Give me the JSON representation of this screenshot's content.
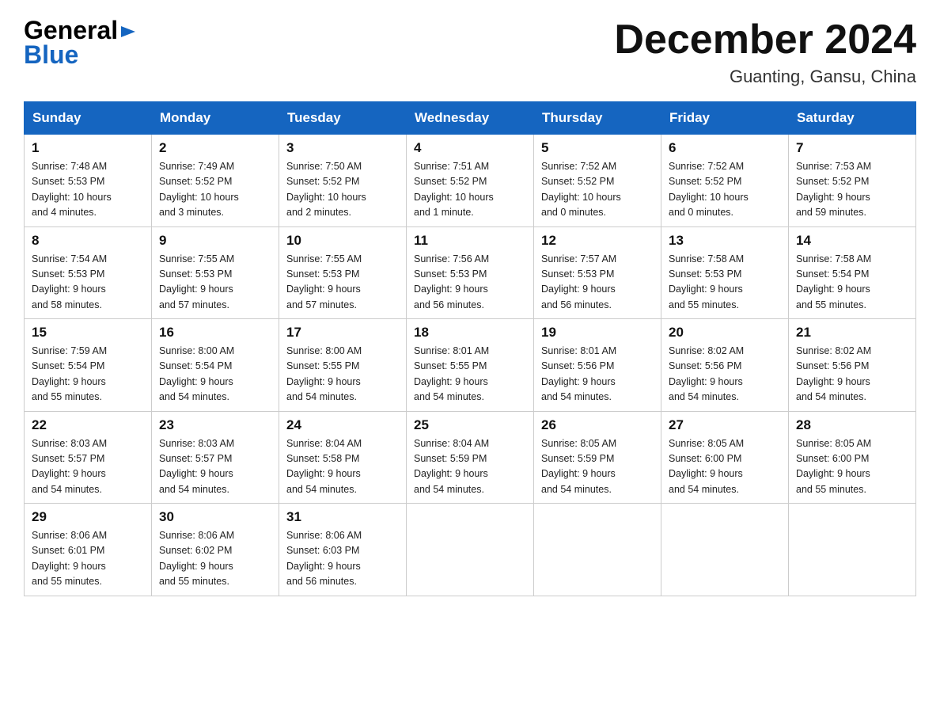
{
  "logo": {
    "general": "General",
    "blue": "Blue",
    "arrow_color": "#1565C0"
  },
  "title": "December 2024",
  "location": "Guanting, Gansu, China",
  "weekdays": [
    "Sunday",
    "Monday",
    "Tuesday",
    "Wednesday",
    "Thursday",
    "Friday",
    "Saturday"
  ],
  "weeks": [
    [
      {
        "day": "1",
        "info": "Sunrise: 7:48 AM\nSunset: 5:53 PM\nDaylight: 10 hours\nand 4 minutes."
      },
      {
        "day": "2",
        "info": "Sunrise: 7:49 AM\nSunset: 5:52 PM\nDaylight: 10 hours\nand 3 minutes."
      },
      {
        "day": "3",
        "info": "Sunrise: 7:50 AM\nSunset: 5:52 PM\nDaylight: 10 hours\nand 2 minutes."
      },
      {
        "day": "4",
        "info": "Sunrise: 7:51 AM\nSunset: 5:52 PM\nDaylight: 10 hours\nand 1 minute."
      },
      {
        "day": "5",
        "info": "Sunrise: 7:52 AM\nSunset: 5:52 PM\nDaylight: 10 hours\nand 0 minutes."
      },
      {
        "day": "6",
        "info": "Sunrise: 7:52 AM\nSunset: 5:52 PM\nDaylight: 10 hours\nand 0 minutes."
      },
      {
        "day": "7",
        "info": "Sunrise: 7:53 AM\nSunset: 5:52 PM\nDaylight: 9 hours\nand 59 minutes."
      }
    ],
    [
      {
        "day": "8",
        "info": "Sunrise: 7:54 AM\nSunset: 5:53 PM\nDaylight: 9 hours\nand 58 minutes."
      },
      {
        "day": "9",
        "info": "Sunrise: 7:55 AM\nSunset: 5:53 PM\nDaylight: 9 hours\nand 57 minutes."
      },
      {
        "day": "10",
        "info": "Sunrise: 7:55 AM\nSunset: 5:53 PM\nDaylight: 9 hours\nand 57 minutes."
      },
      {
        "day": "11",
        "info": "Sunrise: 7:56 AM\nSunset: 5:53 PM\nDaylight: 9 hours\nand 56 minutes."
      },
      {
        "day": "12",
        "info": "Sunrise: 7:57 AM\nSunset: 5:53 PM\nDaylight: 9 hours\nand 56 minutes."
      },
      {
        "day": "13",
        "info": "Sunrise: 7:58 AM\nSunset: 5:53 PM\nDaylight: 9 hours\nand 55 minutes."
      },
      {
        "day": "14",
        "info": "Sunrise: 7:58 AM\nSunset: 5:54 PM\nDaylight: 9 hours\nand 55 minutes."
      }
    ],
    [
      {
        "day": "15",
        "info": "Sunrise: 7:59 AM\nSunset: 5:54 PM\nDaylight: 9 hours\nand 55 minutes."
      },
      {
        "day": "16",
        "info": "Sunrise: 8:00 AM\nSunset: 5:54 PM\nDaylight: 9 hours\nand 54 minutes."
      },
      {
        "day": "17",
        "info": "Sunrise: 8:00 AM\nSunset: 5:55 PM\nDaylight: 9 hours\nand 54 minutes."
      },
      {
        "day": "18",
        "info": "Sunrise: 8:01 AM\nSunset: 5:55 PM\nDaylight: 9 hours\nand 54 minutes."
      },
      {
        "day": "19",
        "info": "Sunrise: 8:01 AM\nSunset: 5:56 PM\nDaylight: 9 hours\nand 54 minutes."
      },
      {
        "day": "20",
        "info": "Sunrise: 8:02 AM\nSunset: 5:56 PM\nDaylight: 9 hours\nand 54 minutes."
      },
      {
        "day": "21",
        "info": "Sunrise: 8:02 AM\nSunset: 5:56 PM\nDaylight: 9 hours\nand 54 minutes."
      }
    ],
    [
      {
        "day": "22",
        "info": "Sunrise: 8:03 AM\nSunset: 5:57 PM\nDaylight: 9 hours\nand 54 minutes."
      },
      {
        "day": "23",
        "info": "Sunrise: 8:03 AM\nSunset: 5:57 PM\nDaylight: 9 hours\nand 54 minutes."
      },
      {
        "day": "24",
        "info": "Sunrise: 8:04 AM\nSunset: 5:58 PM\nDaylight: 9 hours\nand 54 minutes."
      },
      {
        "day": "25",
        "info": "Sunrise: 8:04 AM\nSunset: 5:59 PM\nDaylight: 9 hours\nand 54 minutes."
      },
      {
        "day": "26",
        "info": "Sunrise: 8:05 AM\nSunset: 5:59 PM\nDaylight: 9 hours\nand 54 minutes."
      },
      {
        "day": "27",
        "info": "Sunrise: 8:05 AM\nSunset: 6:00 PM\nDaylight: 9 hours\nand 54 minutes."
      },
      {
        "day": "28",
        "info": "Sunrise: 8:05 AM\nSunset: 6:00 PM\nDaylight: 9 hours\nand 55 minutes."
      }
    ],
    [
      {
        "day": "29",
        "info": "Sunrise: 8:06 AM\nSunset: 6:01 PM\nDaylight: 9 hours\nand 55 minutes."
      },
      {
        "day": "30",
        "info": "Sunrise: 8:06 AM\nSunset: 6:02 PM\nDaylight: 9 hours\nand 55 minutes."
      },
      {
        "day": "31",
        "info": "Sunrise: 8:06 AM\nSunset: 6:03 PM\nDaylight: 9 hours\nand 56 minutes."
      },
      {
        "day": "",
        "info": ""
      },
      {
        "day": "",
        "info": ""
      },
      {
        "day": "",
        "info": ""
      },
      {
        "day": "",
        "info": ""
      }
    ]
  ]
}
